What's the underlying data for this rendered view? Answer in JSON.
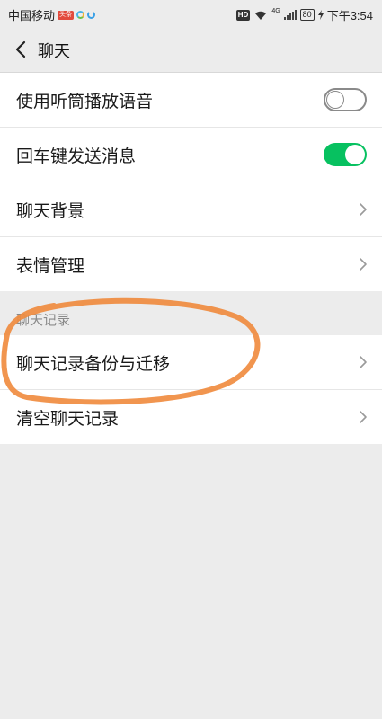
{
  "status_bar": {
    "carrier": "中国移动",
    "badge": "头条",
    "hd": "HD",
    "network": "4G",
    "battery": "80",
    "time": "下午3:54"
  },
  "header": {
    "title": "聊天"
  },
  "groups": [
    {
      "items": [
        {
          "label": "使用听筒播放语音",
          "control": "toggle",
          "on": false
        },
        {
          "label": "回车键发送消息",
          "control": "toggle",
          "on": true
        },
        {
          "label": "聊天背景",
          "control": "chevron"
        },
        {
          "label": "表情管理",
          "control": "chevron"
        }
      ]
    },
    {
      "section_title": "聊天记录",
      "items": [
        {
          "label": "聊天记录备份与迁移",
          "control": "chevron"
        },
        {
          "label": "清空聊天记录",
          "control": "chevron"
        }
      ]
    }
  ],
  "colors": {
    "accent_green": "#07c160",
    "annotation_orange": "#f08a3c",
    "background": "#ececec"
  },
  "icons": [
    "back-arrow-icon",
    "chevron-right-icon",
    "wifi-icon",
    "signal-icon",
    "charging-icon"
  ]
}
